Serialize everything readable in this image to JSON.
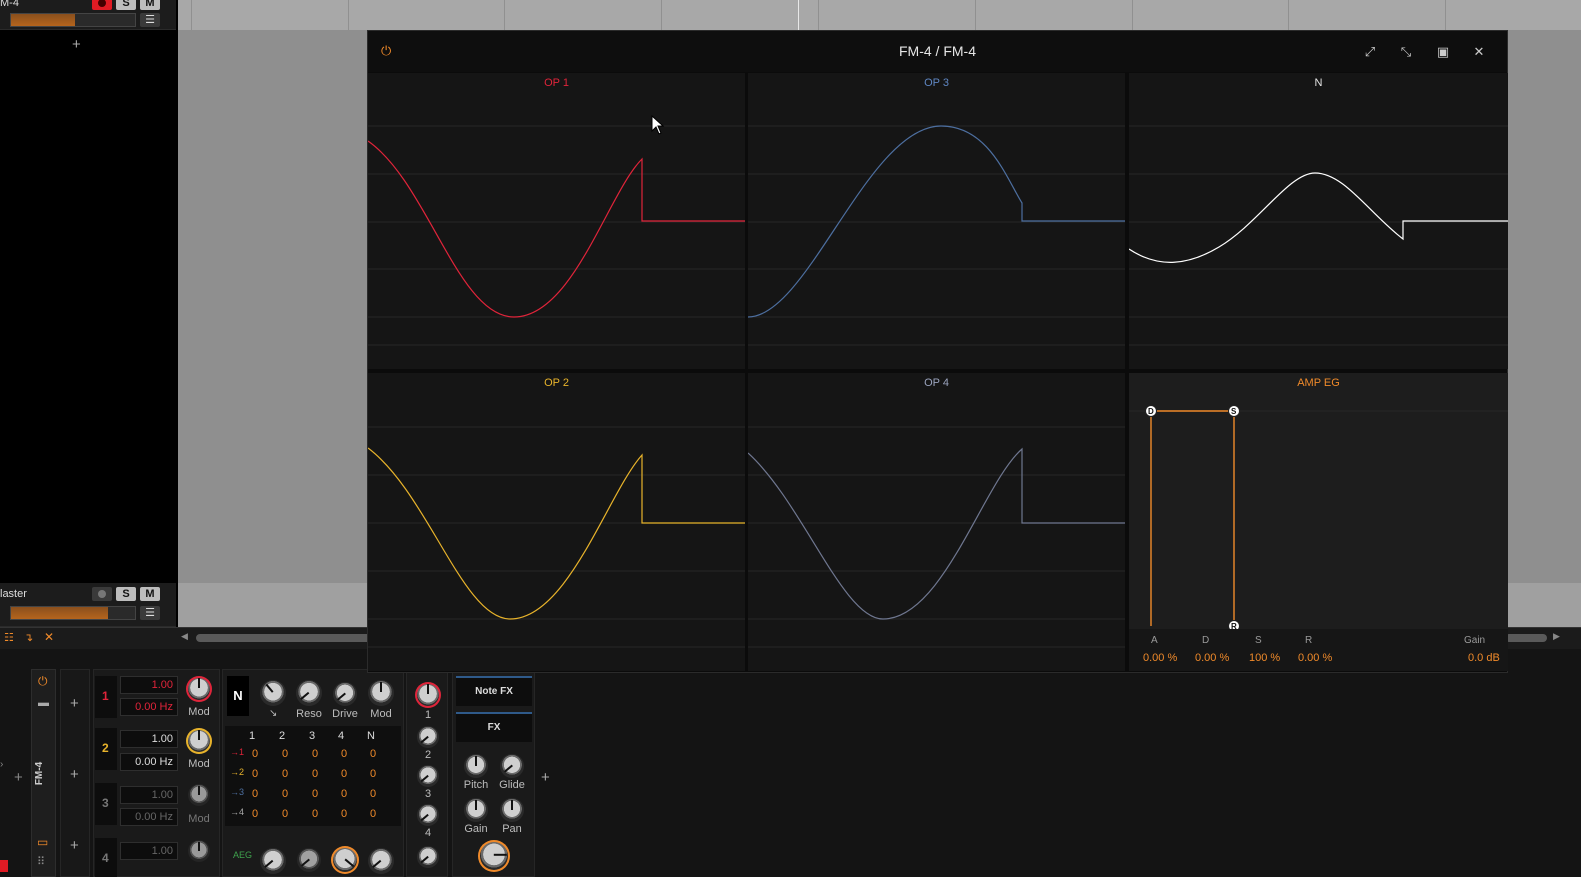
{
  "track": {
    "name": "M-4",
    "s_label": "S",
    "m_label": "M",
    "add_label": "+"
  },
  "master": {
    "name": "laster",
    "s_label": "S",
    "m_label": "M"
  },
  "plugin": {
    "title": "FM-4 / FM-4",
    "panels": {
      "op1": "OP 1",
      "op3": "OP 3",
      "n": "N",
      "op2": "OP 2",
      "op4": "OP 4",
      "amp_eg": "AMP EG"
    },
    "colors": {
      "op1": "#e0243a",
      "op3": "#4d6fa0",
      "n": "#ffffff",
      "op2": "#e8b32b",
      "op4": "#6f7790",
      "amp": "#f08a2a"
    },
    "amp_eg": {
      "labels": {
        "a": "A",
        "d": "D",
        "s": "S",
        "r": "R",
        "gain": "Gain"
      },
      "values": {
        "a": "0.00 %",
        "d": "0.00 %",
        "s": "100 %",
        "r": "0.00 %",
        "gain": "0.0 dB"
      },
      "handles": {
        "d": "D",
        "s": "S",
        "r": "R"
      }
    }
  },
  "device": {
    "name": "FM-4",
    "ops": [
      {
        "num": "1",
        "ratio": "1.00",
        "freq": "0.00 Hz",
        "mod": "Mod"
      },
      {
        "num": "2",
        "ratio": "1.00",
        "freq": "0.00 Hz",
        "mod": "Mod"
      },
      {
        "num": "3",
        "ratio": "1.00",
        "freq": "0.00 Hz",
        "mod": "Mod"
      },
      {
        "num": "4",
        "ratio": "1.00"
      }
    ],
    "filter": {
      "n": "N",
      "reso": "Reso",
      "drive": "Drive",
      "mod": "Mod"
    },
    "matrix": {
      "headers": [
        "1",
        "2",
        "3",
        "4",
        "N"
      ],
      "rows": [
        {
          "label": "→1",
          "values": [
            "0",
            "0",
            "0",
            "0",
            "0"
          ]
        },
        {
          "label": "→2",
          "values": [
            "0",
            "0",
            "0",
            "0",
            "0"
          ]
        },
        {
          "label": "→3",
          "values": [
            "0",
            "0",
            "0",
            "0",
            "0"
          ]
        },
        {
          "label": "→4",
          "values": [
            "0",
            "0",
            "0",
            "0",
            "0"
          ]
        }
      ]
    },
    "out_labels": [
      "1",
      "2",
      "3",
      "4"
    ],
    "aeg": "AEG",
    "note_fx": "Note FX",
    "fx": "FX",
    "pitch": "Pitch",
    "glide": "Glide",
    "gain": "Gain",
    "pan": "Pan",
    "add": "+"
  }
}
